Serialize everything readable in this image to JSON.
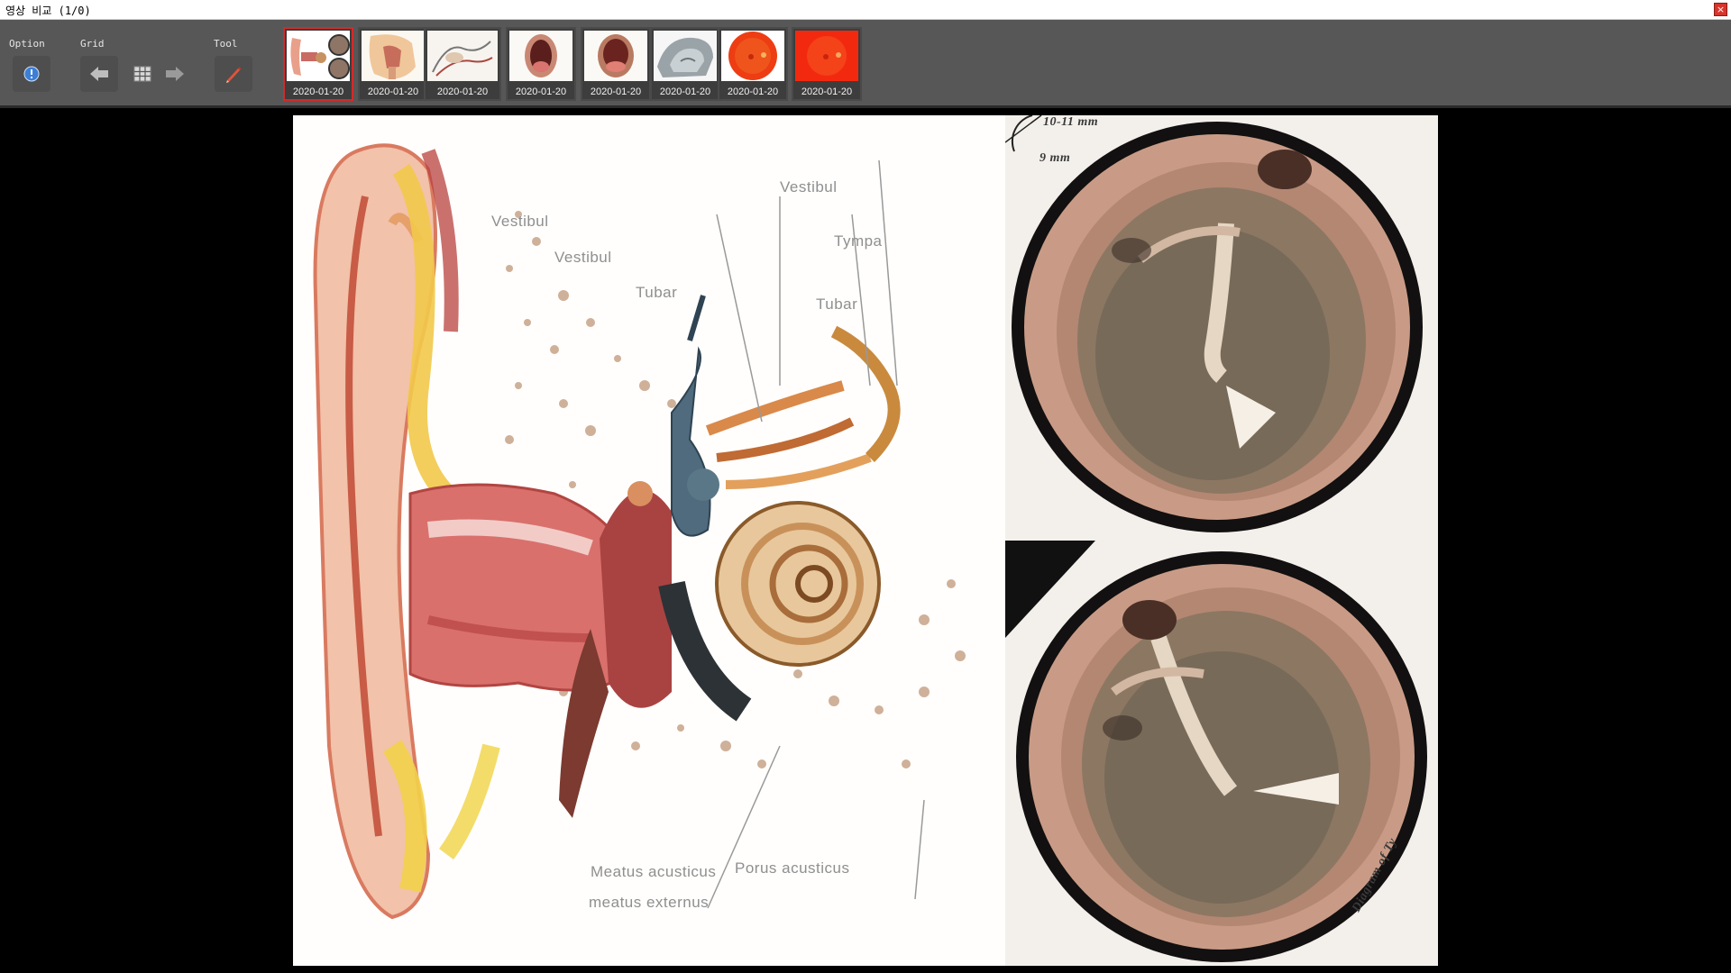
{
  "window": {
    "title": "영상 비교 (1/0)",
    "close_label": "×"
  },
  "toolbar": {
    "option_label": "Option",
    "grid_label": "Grid",
    "tool_label": "Tool",
    "accent_color": "#d42a2a"
  },
  "thumbnails": [
    {
      "date": "2020-01-20",
      "kind": "ear-anatomy"
    },
    {
      "date": "2020-01-20",
      "kind": "head-sagittal"
    },
    {
      "date": "2020-01-20",
      "kind": "sketch-anatomy"
    },
    {
      "date": "2020-01-20",
      "kind": "oral-cavity"
    },
    {
      "date": "2020-01-20",
      "kind": "oral-cavity-2"
    },
    {
      "date": "2020-01-20",
      "kind": "nasal-cavity"
    },
    {
      "date": "2020-01-20",
      "kind": "retina-fundus"
    },
    {
      "date": "2020-01-20",
      "kind": "retina-fundus-2"
    }
  ],
  "viewer": {
    "labels": [
      "Meatus acusticus",
      "meatus externus",
      "Porus acusticus",
      "Tympa",
      "Tubar",
      "Vestibul",
      "10-11 mm",
      "9 mm",
      "Diagram of Ty"
    ]
  }
}
